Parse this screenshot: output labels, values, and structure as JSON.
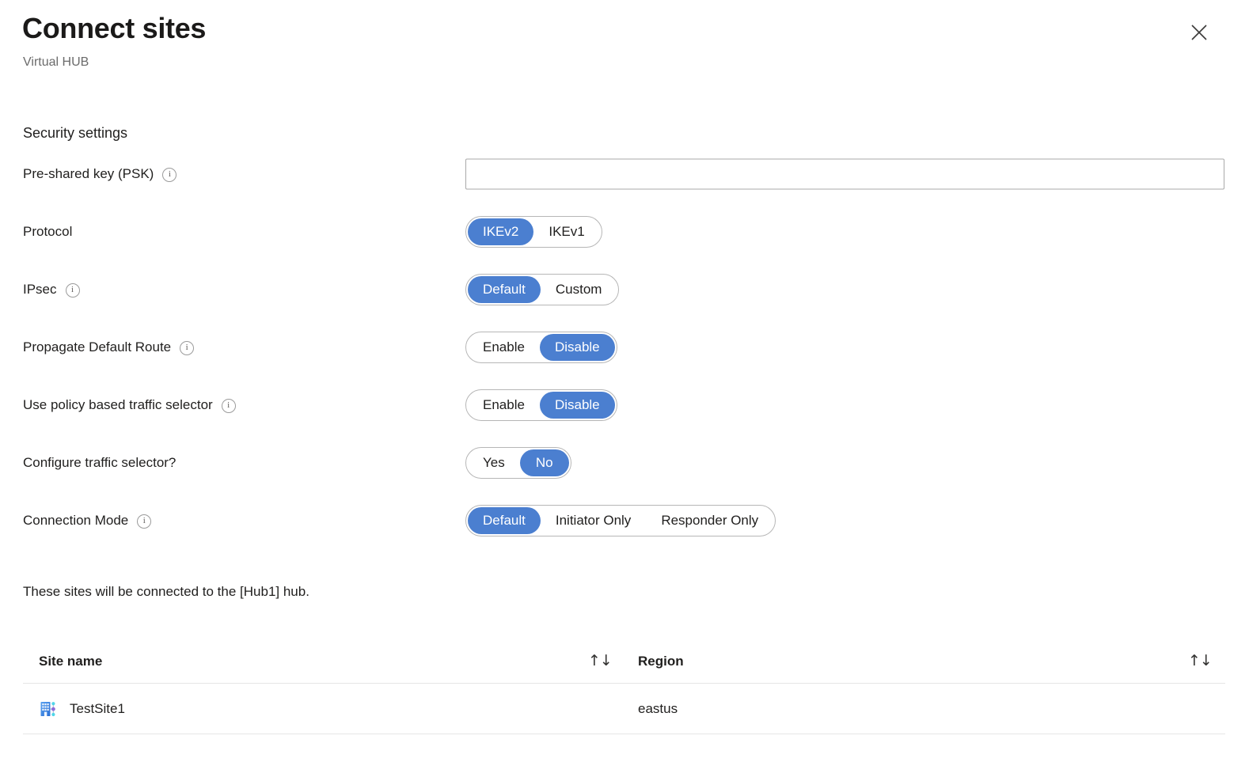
{
  "header": {
    "title": "Connect sites",
    "subtitle": "Virtual HUB",
    "close_label": "Close"
  },
  "form": {
    "section_heading": "Security settings",
    "fields": [
      {
        "id": "psk",
        "label": "Pre-shared key (PSK)",
        "info": true,
        "type": "text",
        "value": "",
        "placeholder": ""
      },
      {
        "id": "protocol",
        "label": "Protocol",
        "info": false,
        "type": "choice",
        "options": [
          "IKEv2",
          "IKEv1"
        ],
        "selected": "IKEv2"
      },
      {
        "id": "ipsec",
        "label": "IPsec",
        "info": true,
        "type": "choice",
        "options": [
          "Default",
          "Custom"
        ],
        "selected": "Default"
      },
      {
        "id": "propagate-default-route",
        "label": "Propagate Default Route",
        "info": true,
        "type": "choice",
        "options": [
          "Enable",
          "Disable"
        ],
        "selected": "Disable"
      },
      {
        "id": "use-policy-based-traffic-selector",
        "label": "Use policy based traffic selector",
        "info": true,
        "type": "choice",
        "options": [
          "Enable",
          "Disable"
        ],
        "selected": "Disable"
      },
      {
        "id": "configure-traffic-selector",
        "label": "Configure traffic selector?",
        "info": false,
        "type": "choice",
        "options": [
          "Yes",
          "No"
        ],
        "selected": "No"
      },
      {
        "id": "connection-mode",
        "label": "Connection Mode",
        "info": true,
        "type": "choice",
        "options": [
          "Default",
          "Initiator Only",
          "Responder Only"
        ],
        "selected": "Default"
      }
    ],
    "info_glyph": "i"
  },
  "sites": {
    "note": "These sites will be connected to the [Hub1] hub.",
    "columns": [
      {
        "label": "Site name",
        "sort_icon": "↑↓"
      },
      {
        "label": "Region",
        "sort_icon": "↑↓"
      }
    ],
    "rows": [
      {
        "site_name": "TestSite1",
        "region": "eastus",
        "icon": "site-building-icon"
      }
    ]
  },
  "colors": {
    "accent_blue": "#4b7fd0",
    "border_gray": "#b6b6b6",
    "divider_gray": "#e6e6e6",
    "text_primary": "#201f1e",
    "text_secondary": "#6b6b6b"
  }
}
